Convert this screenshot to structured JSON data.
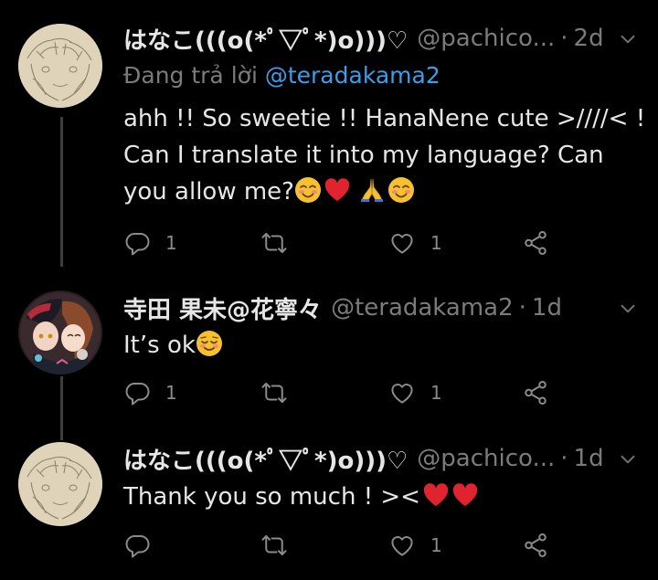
{
  "tweets": [
    {
      "name": "はなこ(((o(*ﾟ▽ﾟ*)o)))♡",
      "handle": "@pachico...",
      "dot": "·",
      "time": "2d",
      "replying_label": "Đang trả lời",
      "replying_to": "@teradakama2",
      "lines": [
        "ahh !! So sweetie !! HanaNene cute >////< !",
        "Can I translate it into my language? Can",
        "you allow me?"
      ],
      "emojis_end": [
        "smiling-blush-emoji",
        "red-heart-emoji",
        "folded-hands-emoji",
        "smiling-blush-emoji"
      ],
      "reply_count": "1",
      "retweet_count": "",
      "like_count": "1"
    },
    {
      "name": "寺田 果未@花寧々",
      "handle": "@teradakama2",
      "dot": "·",
      "time": "1d",
      "lines": [
        "It’s ok"
      ],
      "emojis_end": [
        "relieved-smile-emoji"
      ],
      "reply_count": "1",
      "retweet_count": "",
      "like_count": "1"
    },
    {
      "name": "はなこ(((o(*ﾟ▽ﾟ*)o)))♡",
      "handle": "@pachico...",
      "dot": "·",
      "time": "1d",
      "lines": [
        "Thank you so much ! ><"
      ],
      "emojis_end": [
        "red-heart-emoji",
        "red-heart-emoji"
      ],
      "reply_count": "",
      "retweet_count": "",
      "like_count": "1"
    }
  ],
  "colors": {
    "background": "#000000",
    "text": "#e6e6e6",
    "muted": "#7b7b7b",
    "mention": "#3b9ee8",
    "thread_line": "#3d3d3d"
  }
}
